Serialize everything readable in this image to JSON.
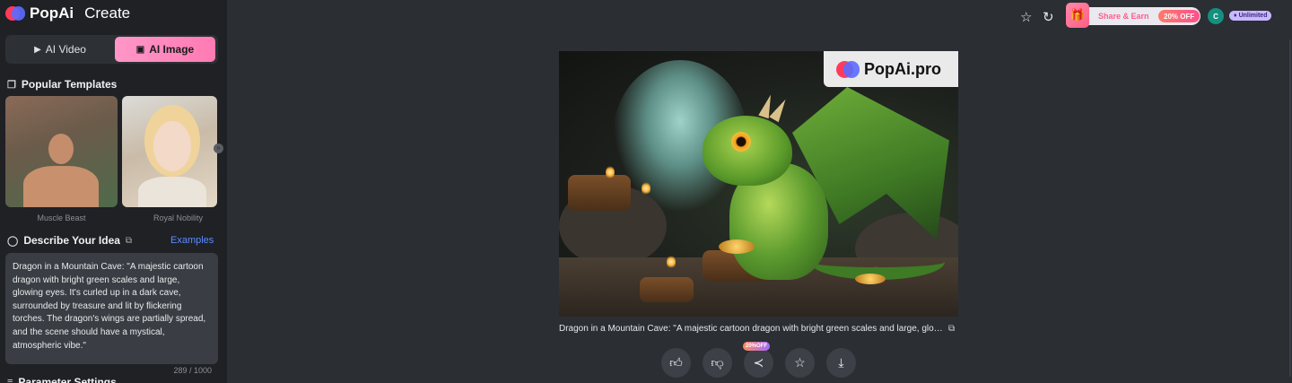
{
  "brand": {
    "name": "PopAi",
    "section": "Create"
  },
  "mode_switch": {
    "video_label": "AI Video",
    "image_label": "AI Image",
    "selected": "AI Image"
  },
  "templates": {
    "title": "Popular Templates",
    "items": [
      {
        "label": "Muscle Beast"
      },
      {
        "label": "Royal Nobility"
      }
    ]
  },
  "describe": {
    "title": "Describe Your Idea",
    "examples_label": "Examples",
    "prompt": "Dragon in a Mountain Cave: \"A majestic cartoon dragon with bright green scales and large, glowing eyes. It's curled up in a dark cave, surrounded by treasure and lit by flickering torches. The dragon's wings are partially spread, and the scene should have a mystical, atmospheric vibe.\"",
    "counter": "289 / 1000"
  },
  "parameters": {
    "title": "Parameter Settings"
  },
  "topbar": {
    "share_label": "Share & Earn",
    "share_discount": "20% OFF",
    "avatar_initial": "C",
    "plan_badge": "Unlimited"
  },
  "result": {
    "watermark": "PopAi.pro",
    "caption": "Dragon in a Mountain Cave: \"A majestic cartoon dragon with bright green scales and large, glowing eyes. It's curled up in a dark cave, surrounded by treasure and lit by flickering torches.",
    "share_badge": "20%OFF"
  },
  "icons": {
    "favorite": "star-icon",
    "history": "history-icon",
    "like": "thumbs-up-icon",
    "dislike": "thumbs-down-icon",
    "share": "share-icon",
    "download": "download-icon",
    "copy": "copy-icon"
  },
  "colors": {
    "accent_pink": "#ff7ab3",
    "link_blue": "#5b8cff",
    "sidebar_bg": "#1f2125",
    "main_bg": "#2b2e33"
  }
}
